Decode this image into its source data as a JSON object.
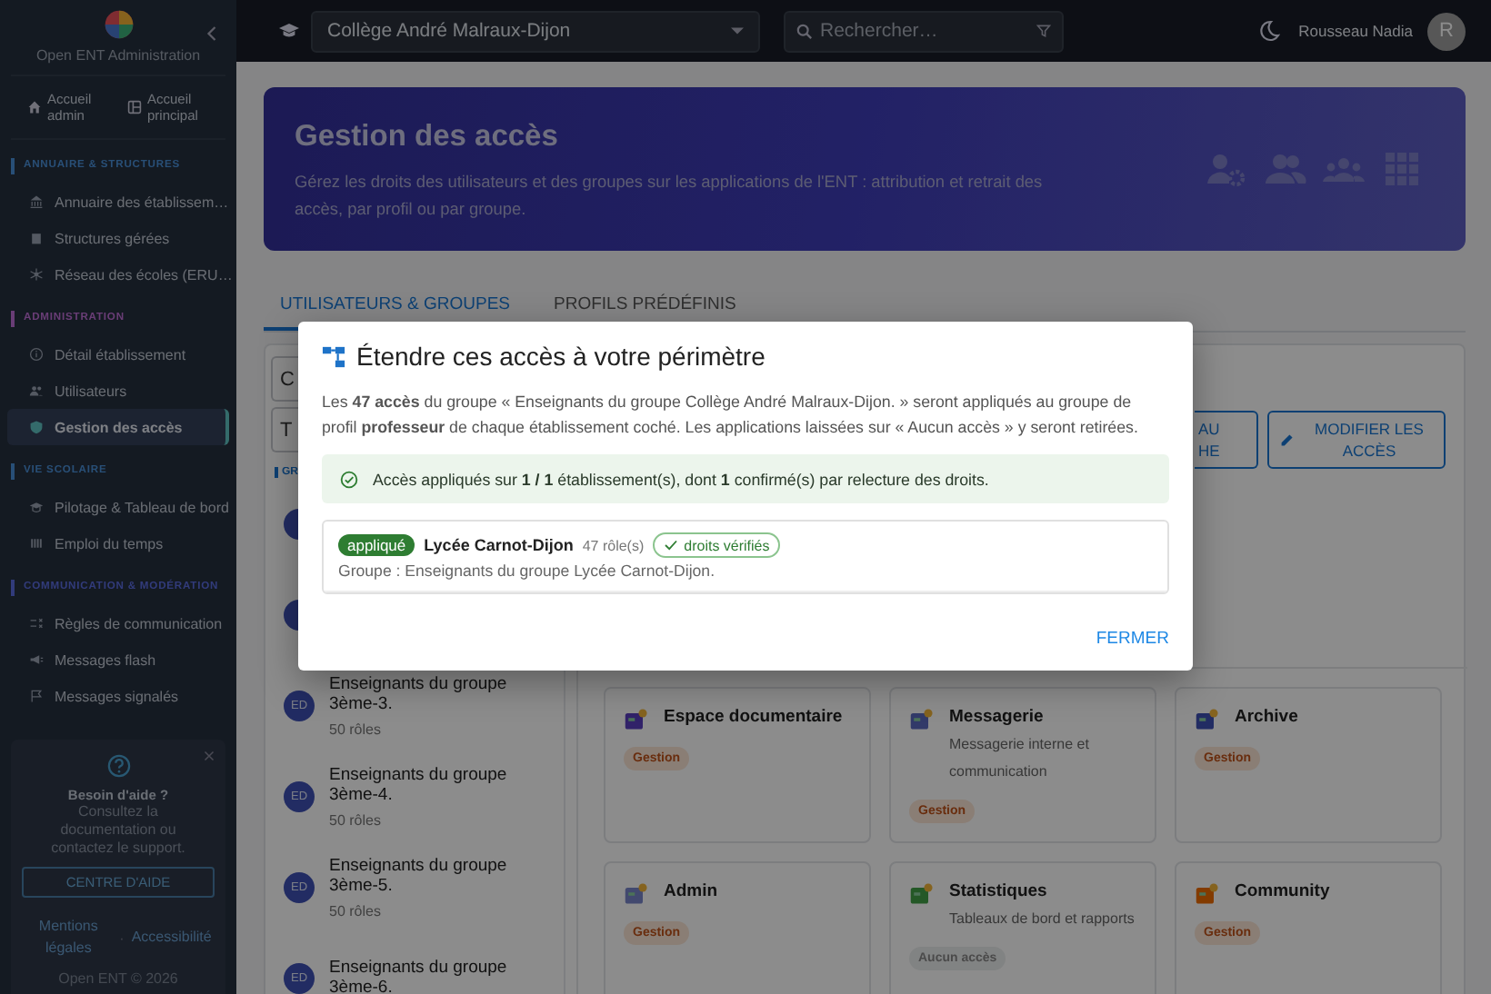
{
  "sidebar": {
    "brand": "Open ENT Administration",
    "home_links": [
      "Accueil admin",
      "Accueil principal"
    ],
    "sections": [
      {
        "title": "ANNUAIRE & STRUCTURES",
        "items": [
          {
            "label": "Annuaire des établissem…",
            "selected": false
          },
          {
            "label": "Structures gérées",
            "selected": false
          },
          {
            "label": "Réseau des écoles (ERU…",
            "selected": false
          }
        ]
      },
      {
        "title": "ADMINISTRATION",
        "items": [
          {
            "label": "Détail établissement",
            "selected": false
          },
          {
            "label": "Utilisateurs",
            "selected": false
          },
          {
            "label": "Gestion des accès",
            "selected": true
          }
        ]
      },
      {
        "title": "VIE SCOLAIRE",
        "items": [
          {
            "label": "Pilotage & Tableau de bord",
            "selected": false
          },
          {
            "label": "Emploi du temps",
            "selected": false
          }
        ]
      },
      {
        "title": "COMMUNICATION & MODÉRATION",
        "items": [
          {
            "label": "Règles de communication",
            "selected": false
          },
          {
            "label": "Messages flash",
            "selected": false
          },
          {
            "label": "Messages signalés",
            "selected": false
          }
        ]
      }
    ],
    "help": {
      "title": "Besoin d'aide ?",
      "text": "Consultez la documentation ou contactez le support.",
      "button": "CENTRE D'AIDE",
      "links": [
        "Mentions légales",
        "Accessibilité"
      ],
      "separator": "·",
      "footer": "Open ENT © 2026"
    }
  },
  "topbar": {
    "school": "Collège André Malraux-Dijon",
    "search": {
      "placeholder": "Rechercher…"
    },
    "user": "Rousseau Nadia",
    "avatar": "R"
  },
  "banner": {
    "title": "Gestion des accès",
    "description": "Gérez les droits des utilisateurs et des groupes sur les applications de l'ENT : attribution et retrait des accès, par profil ou par groupe."
  },
  "tabs": [
    {
      "label": "UTILISATEURS & GROUPES",
      "selected": true
    },
    {
      "label": "PROFILS PRÉDÉFINIS",
      "selected": false
    }
  ],
  "left_panel": {
    "fields": [
      "C",
      "T"
    ],
    "list_label": "GR",
    "groups": [
      {
        "avatar": "ED",
        "name": "Enseignants du groupe 3ème-3.",
        "roles": "50 rôles"
      },
      {
        "avatar": "ED",
        "name": "Enseignants du groupe 3ème-4.",
        "roles": "50 rôles"
      },
      {
        "avatar": "ED",
        "name": "Enseignants du groupe 3ème-5.",
        "roles": "50 rôles"
      },
      {
        "avatar": "ED",
        "name": "Enseignants du groupe 3ème-6."
      }
    ]
  },
  "actions": {
    "partial_button": [
      "AU",
      "HE"
    ],
    "edit_button": "MODIFIER LES ACCÈS"
  },
  "apps": [
    {
      "name": "Espace documentaire",
      "access": {
        "label": "Gestion",
        "kind": "manage"
      }
    },
    {
      "name": "Messagerie",
      "description": "Messagerie interne et communication",
      "access": {
        "label": "Gestion",
        "kind": "manage"
      }
    },
    {
      "name": "Archive",
      "access": {
        "label": "Gestion",
        "kind": "manage"
      }
    },
    {
      "name": "Admin",
      "access": {
        "label": "Gestion",
        "kind": "manage"
      }
    },
    {
      "name": "Statistiques",
      "description": "Tableaux de bord et rapports",
      "access": {
        "label": "Aucun accès",
        "kind": "none"
      }
    },
    {
      "name": "Community",
      "access": {
        "label": "Gestion",
        "kind": "manage"
      }
    }
  ],
  "dialog": {
    "title": "Étendre ces accès à votre périmètre",
    "message": "Les **47 accès** du groupe « Enseignants du groupe Collège André Malraux-Dijon. » seront appliqués au groupe de profil **professeur** de chaque établissement coché. Les applications laissées sur « Aucun accès » y seront retirées.",
    "alert": "Accès appliqués sur **1 / 1** établissement(s), dont **1** confirmé(s) par relecture des droits.",
    "results": [
      {
        "status": {
          "label": "appliqué",
          "kind": "applied"
        },
        "name": "Lycée Carnot-Dijon",
        "roles": "47 rôle(s)",
        "check": "droits vérifiés",
        "group": "Groupe : Enseignants du groupe Lycée Carnot-Dijon."
      }
    ],
    "close": "FERMER"
  }
}
